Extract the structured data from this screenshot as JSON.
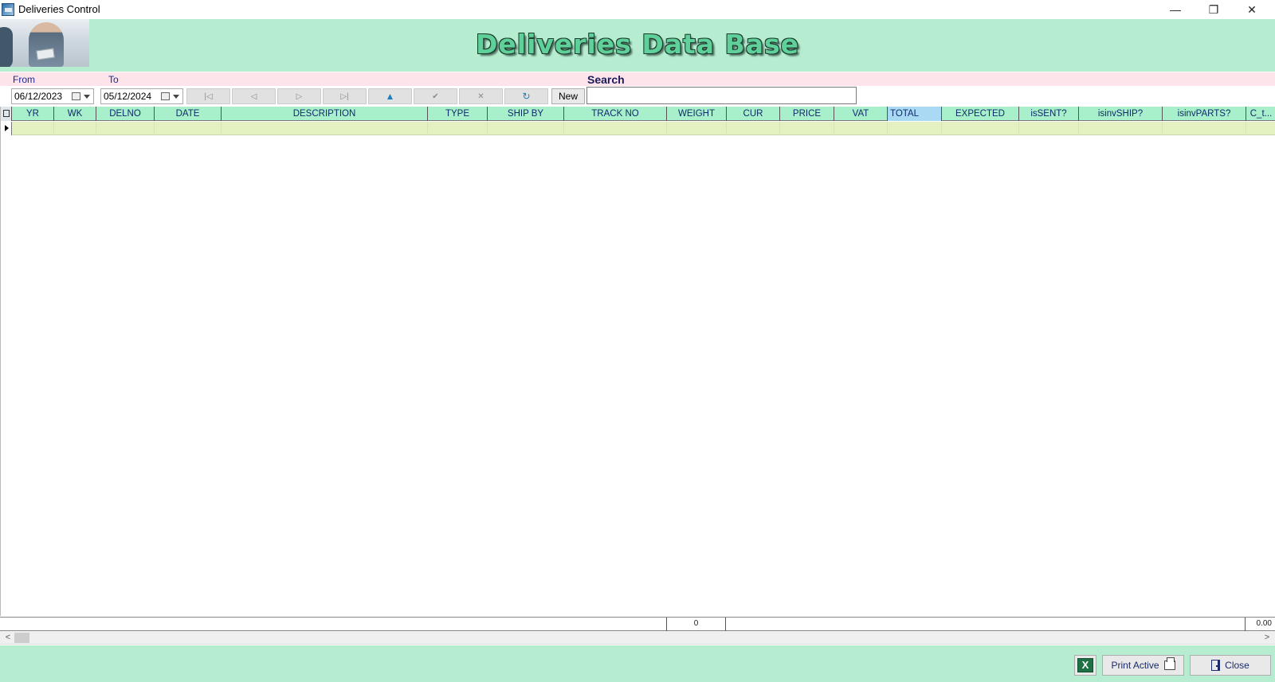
{
  "window": {
    "title": "Deliveries Control",
    "minimize": "—",
    "maximize": "❐",
    "close": "✕"
  },
  "header": {
    "title": "Deliveries Data Base"
  },
  "filters": {
    "from_label": "From",
    "to_label": "To",
    "from_value": "06/12/2023",
    "to_value": "05/12/2024",
    "search_label": "Search",
    "search_value": ""
  },
  "navigator": {
    "first": "|◁",
    "prior": "◁",
    "next": "▷",
    "last": "▷|",
    "edit": "▲",
    "post": "✔",
    "cancel": "✕",
    "refresh": "↻",
    "new_label": "New"
  },
  "grid": {
    "columns": [
      "YR",
      "WK",
      "DELNO",
      "DATE",
      "DESCRIPTION",
      "TYPE",
      "SHIP BY",
      "TRACK NO",
      "WEIGHT",
      "CUR",
      "PRICE",
      "VAT",
      "TOTAL",
      "EXPECTED",
      "isSENT?",
      "isinvSHIP?",
      "isinvPARTS?",
      "C_t..."
    ],
    "footer_count": "0",
    "footer_total": "0.00"
  },
  "scrollbar": {
    "left": "<",
    "right": ">"
  },
  "bottom": {
    "excel_label": "X",
    "print_label": "Print Active",
    "close_label": "Close"
  },
  "colors": {
    "banner": "#b6edd0",
    "grid_header": "#a8efcb",
    "row": "#e4f2c2",
    "selected_header": "#a9d9f3",
    "filter_strip": "#fde4ea"
  }
}
